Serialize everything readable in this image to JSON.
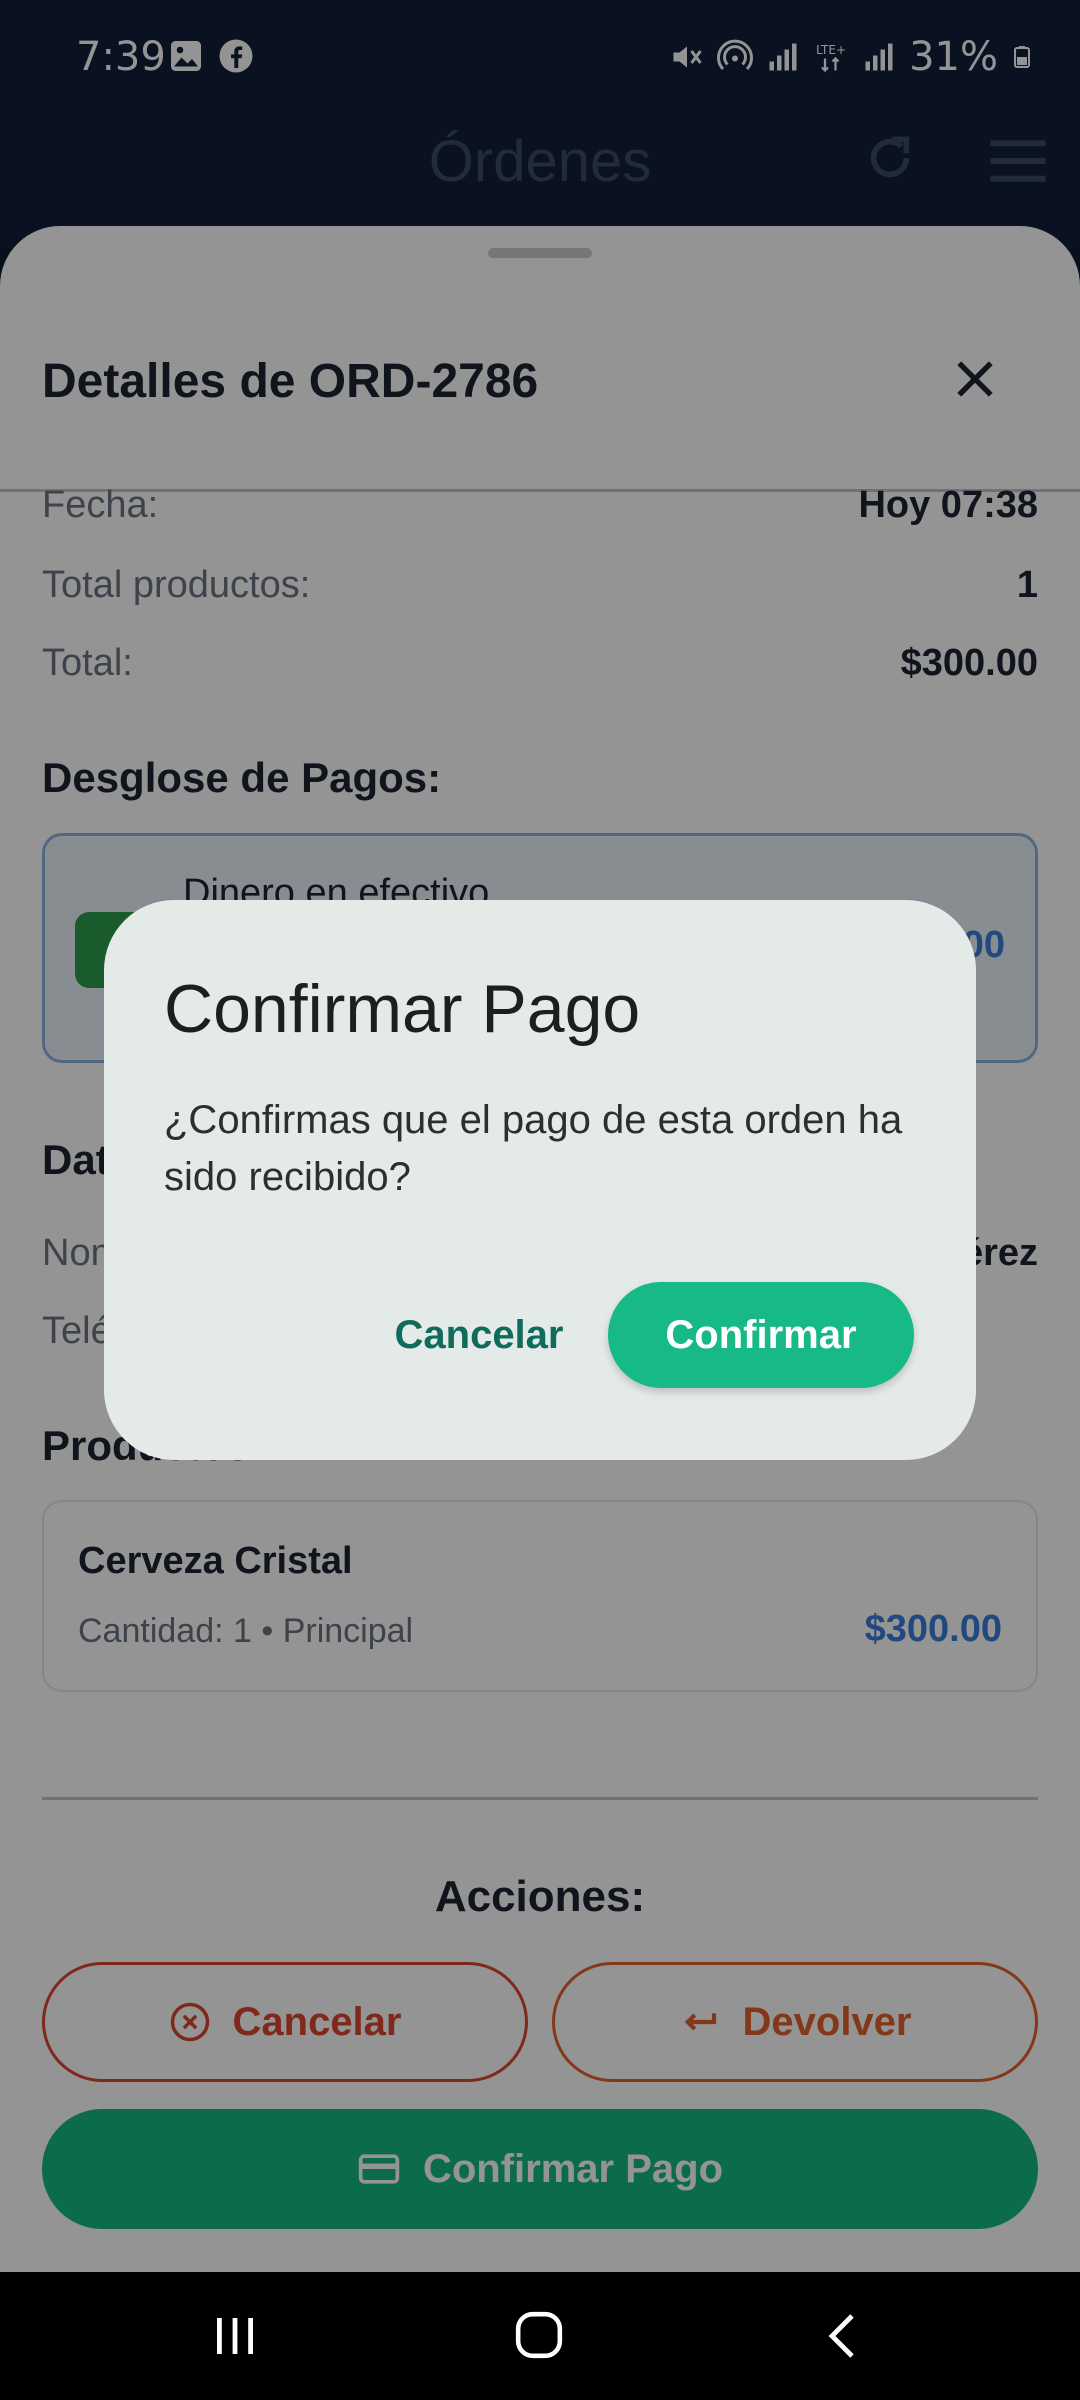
{
  "status_bar": {
    "time": "7:39",
    "battery": "31%",
    "icons_left": [
      "image-icon",
      "facebook-icon"
    ],
    "icons_right": [
      "mute-icon",
      "hotspot-icon",
      "signal-icon",
      "lte-icon",
      "signal-icon",
      "battery-icon"
    ]
  },
  "app_bar": {
    "title": "Órdenes",
    "icons": [
      "refresh-icon",
      "menu-icon"
    ]
  },
  "sheet": {
    "title": "Detalles de ORD-2786",
    "summary": [
      {
        "label": "Fecha:",
        "value": "Hoy 07:38"
      },
      {
        "label": "Total productos:",
        "value": "1"
      },
      {
        "label": "Total:",
        "value": "$300.00"
      }
    ],
    "payments_heading": "Desglose de Pagos:",
    "payment": {
      "method": "Dinero en efectivo",
      "amount": "$300.00"
    },
    "client_heading": "Datos del Cliente:",
    "client": [
      {
        "label": "Nombre:",
        "value": "Juan Pérez"
      },
      {
        "label": "Teléfono:",
        "value": ""
      }
    ],
    "products_heading": "Productos:",
    "products": [
      {
        "name": "Cerveza Cristal",
        "meta": "Cantidad: 1 • Principal",
        "price": "$300.00"
      }
    ],
    "actions_heading": "Acciones:",
    "actions": {
      "cancel": "Cancelar",
      "return": "Devolver",
      "confirm_payment": "Confirmar Pago"
    }
  },
  "dialog": {
    "title": "Confirmar Pago",
    "body": "¿Confirmas que el pago de esta orden ha sido recibido?",
    "cancel": "Cancelar",
    "confirm": "Confirmar"
  },
  "colors": {
    "primary_green": "#17b986",
    "danger_red": "#d9472b",
    "warning_orange": "#e2622c",
    "link_blue": "#3b7ddd",
    "header_navy": "#12203a",
    "dialog_bg": "#e4eae8"
  }
}
